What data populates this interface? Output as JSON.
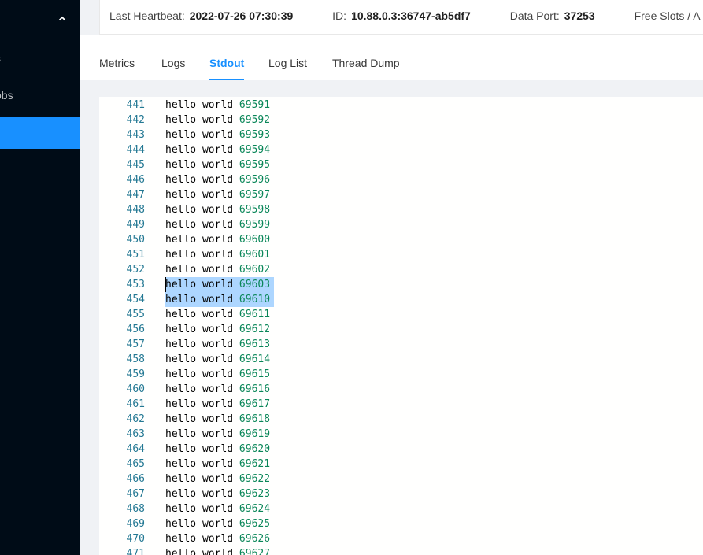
{
  "sidebar": {
    "items": [
      {
        "label": "s"
      },
      {
        "label": "obs"
      },
      {
        "label": ""
      }
    ]
  },
  "header": {
    "items": [
      {
        "label": "Last Heartbeat:",
        "value": "2022-07-26 07:30:39"
      },
      {
        "label": "ID:",
        "value": "10.88.0.3:36747-ab5df7"
      },
      {
        "label": "Data Port:",
        "value": "37253"
      },
      {
        "label": "Free Slots / A",
        "value": ""
      }
    ]
  },
  "tabs": [
    {
      "label": "Metrics"
    },
    {
      "label": "Logs"
    },
    {
      "label": "Stdout"
    },
    {
      "label": "Log List"
    },
    {
      "label": "Thread Dump"
    }
  ],
  "active_tab": "Stdout",
  "log": {
    "prefix": "hello world",
    "selected_lines": [
      453,
      454
    ],
    "lines": [
      {
        "n": "441",
        "v": "69591"
      },
      {
        "n": "442",
        "v": "69592"
      },
      {
        "n": "443",
        "v": "69593"
      },
      {
        "n": "444",
        "v": "69594"
      },
      {
        "n": "445",
        "v": "69595"
      },
      {
        "n": "446",
        "v": "69596"
      },
      {
        "n": "447",
        "v": "69597"
      },
      {
        "n": "448",
        "v": "69598"
      },
      {
        "n": "449",
        "v": "69599"
      },
      {
        "n": "450",
        "v": "69600"
      },
      {
        "n": "451",
        "v": "69601"
      },
      {
        "n": "452",
        "v": "69602"
      },
      {
        "n": "453",
        "v": "69603"
      },
      {
        "n": "454",
        "v": "69610"
      },
      {
        "n": "455",
        "v": "69611"
      },
      {
        "n": "456",
        "v": "69612"
      },
      {
        "n": "457",
        "v": "69613"
      },
      {
        "n": "458",
        "v": "69614"
      },
      {
        "n": "459",
        "v": "69615"
      },
      {
        "n": "460",
        "v": "69616"
      },
      {
        "n": "461",
        "v": "69617"
      },
      {
        "n": "462",
        "v": "69618"
      },
      {
        "n": "463",
        "v": "69619"
      },
      {
        "n": "464",
        "v": "69620"
      },
      {
        "n": "465",
        "v": "69621"
      },
      {
        "n": "466",
        "v": "69622"
      },
      {
        "n": "467",
        "v": "69623"
      },
      {
        "n": "468",
        "v": "69624"
      },
      {
        "n": "469",
        "v": "69625"
      },
      {
        "n": "470",
        "v": "69626"
      },
      {
        "n": "471",
        "v": "69627"
      }
    ]
  },
  "colors": {
    "sidebar_bg": "#001529",
    "accent": "#1890ff",
    "line_number": "#237893",
    "number_literal": "#098658",
    "selection": "#add6ff"
  }
}
